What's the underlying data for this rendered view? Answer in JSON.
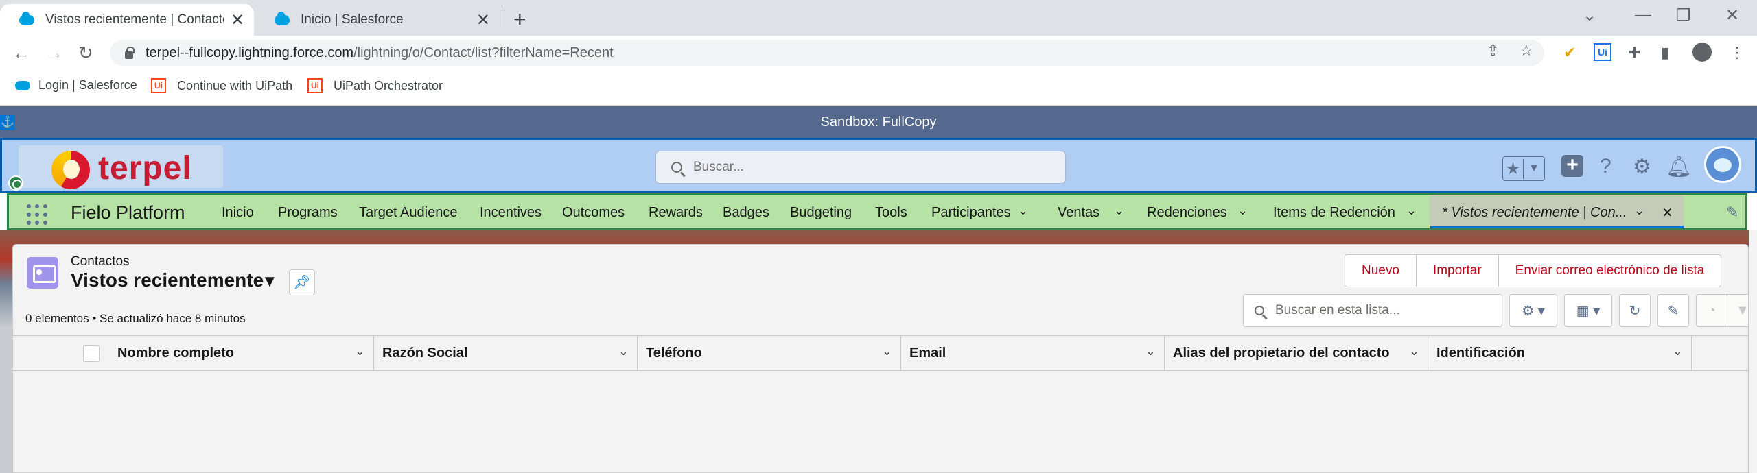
{
  "browser": {
    "tabs": [
      {
        "title": "Vistos recientemente | Contactos",
        "active": true
      },
      {
        "title": "Inicio | Salesforce",
        "active": false
      }
    ],
    "url_host": "terpel--fullcopy.lightning.force.com",
    "url_path": "/lightning/o/Contact/list?filterName=Recent",
    "bookmarks": [
      "Login | Salesforce",
      "Continue with UiPath",
      "UiPath Orchestrator"
    ],
    "ext_uipath_label": "Ui"
  },
  "salesforce": {
    "sandbox_label": "Sandbox: FullCopy",
    "logo_text": "terpel",
    "search_placeholder": "Buscar...",
    "app_name": "Fielo Platform",
    "nav_items": [
      {
        "label": "Inicio"
      },
      {
        "label": "Programs"
      },
      {
        "label": "Target Audience"
      },
      {
        "label": "Incentives"
      },
      {
        "label": "Outcomes"
      },
      {
        "label": "Rewards"
      },
      {
        "label": "Badges"
      },
      {
        "label": "Budgeting"
      },
      {
        "label": "Tools"
      },
      {
        "label": "Participantes",
        "dropdown": true
      },
      {
        "label": "Ventas",
        "dropdown": true
      },
      {
        "label": "Redenciones",
        "dropdown": true
      },
      {
        "label": "Items de Redención",
        "dropdown": true
      }
    ],
    "active_tab_label": "* Vistos recientemente | Con..."
  },
  "list_view": {
    "object_label": "Contactos",
    "title": "Vistos recientemente",
    "buttons": [
      "Nuevo",
      "Importar",
      "Enviar correo electrónico de lista"
    ],
    "meta": "0 elementos • Se actualizó hace 8 minutos",
    "search_placeholder": "Buscar en esta lista...",
    "columns": [
      "Nombre completo",
      "Razón Social",
      "Teléfono",
      "Email",
      "Alias del propietario del contacto",
      "Identificación"
    ]
  },
  "colors": {
    "sandbox_bar": "#54698d",
    "header_highlight": "#b0cdf4",
    "nav_highlight": "#b6e2a6",
    "brand_red": "#c51d34",
    "action_text": "#ba0517"
  }
}
